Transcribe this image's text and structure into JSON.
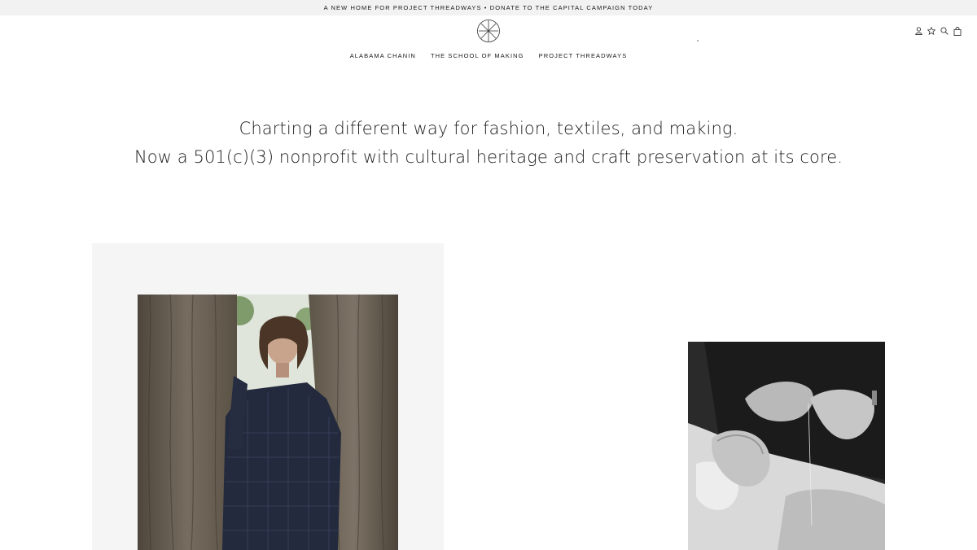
{
  "announcement": {
    "text": "A NEW HOME FOR PROJECT THREADWAYS • DONATE TO THE CAPITAL CAMPAIGN TODAY"
  },
  "header": {
    "logo_icon": "asterisk-circle-logo-icon",
    "utility_icons": [
      "account-icon",
      "star-icon",
      "search-icon",
      "bag-icon"
    ]
  },
  "nav": {
    "items": [
      {
        "label": "ALABAMA CHANIN"
      },
      {
        "label": "THE SCHOOL OF MAKING"
      },
      {
        "label": "PROJECT THREADWAYS"
      }
    ]
  },
  "hero": {
    "line1": "Charting a different way for fashion, textiles, and making.",
    "line2": "Now a 501(c)(3) nonprofit with cultural heritage and craft preservation at its core."
  },
  "colors": {
    "announcement_bg": "#f2f2f2",
    "panel_bg": "#f5f5f5",
    "text": "#1a1a1a"
  }
}
